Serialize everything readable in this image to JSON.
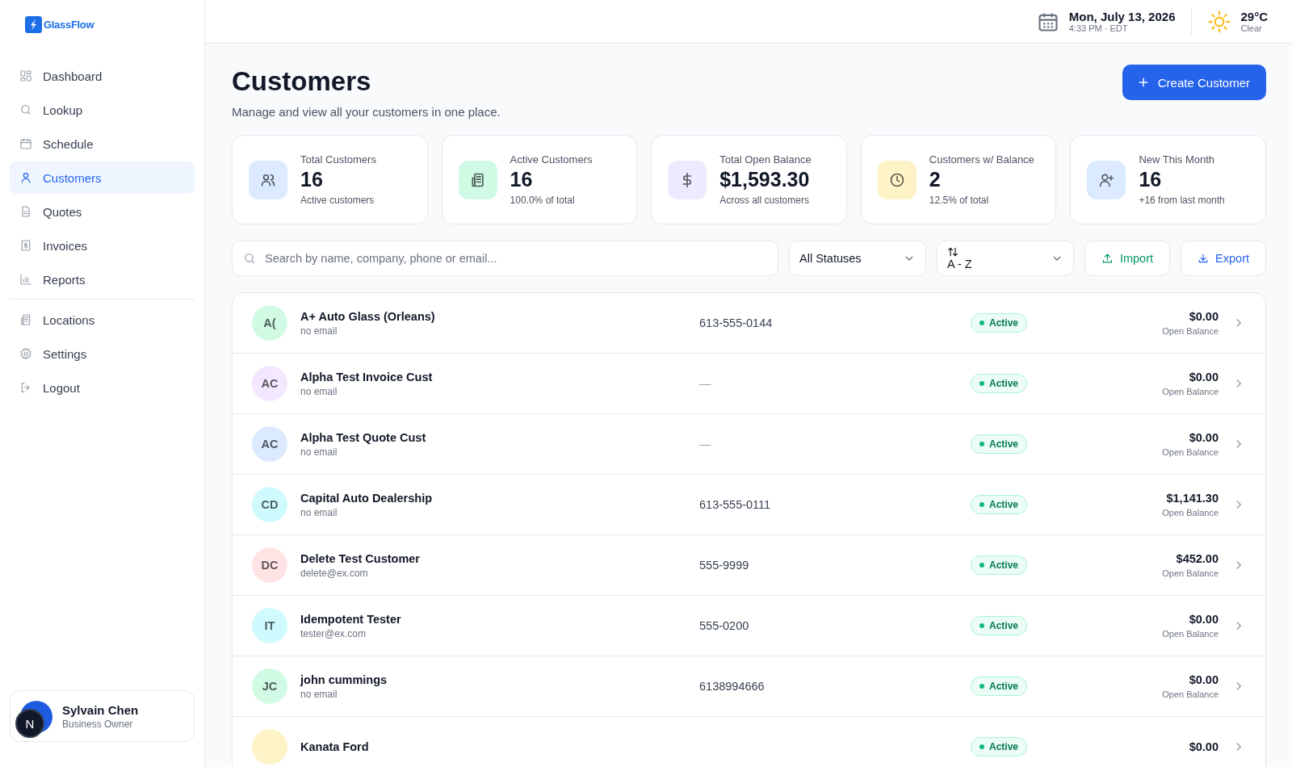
{
  "brand": {
    "name": "GlassFlow"
  },
  "nav": [
    {
      "label": "Dashboard",
      "selected": false
    },
    {
      "label": "Lookup",
      "selected": false
    },
    {
      "label": "Schedule",
      "selected": false
    },
    {
      "label": "Customers",
      "selected": true
    },
    {
      "label": "Quotes",
      "selected": false
    },
    {
      "label": "Invoices",
      "selected": false
    },
    {
      "label": "Reports",
      "selected": false
    }
  ],
  "nav_secondary": [
    {
      "label": "Locations",
      "selected": false
    },
    {
      "label": "Settings",
      "selected": false
    },
    {
      "label": "Logout",
      "selected": false
    }
  ],
  "user": {
    "name": "Sylvain Chen",
    "role": "Business Owner",
    "dev_badge": "N"
  },
  "header": {
    "date": "Mon, July 13, 2026",
    "time": "4:33 PM · EDT",
    "temperature": "29°C",
    "condition": "Clear"
  },
  "page": {
    "title": "Customers",
    "subtitle": "Manage and view all your customers in one place.",
    "create_button": "Create Customer"
  },
  "stats": [
    {
      "label": "Total Customers",
      "value": "16",
      "note": "Active customers",
      "color": "#dbeafe"
    },
    {
      "label": "Active Customers",
      "value": "16",
      "note": "100.0% of total",
      "color": "#d1fae5"
    },
    {
      "label": "Total Open Balance",
      "value": "$1,593.30",
      "note": "Across all customers",
      "color": "#ede9fe"
    },
    {
      "label": "Customers w/ Balance",
      "value": "2",
      "note": "12.5% of total",
      "color": "#fef3c7"
    },
    {
      "label": "New This Month",
      "value": "16",
      "note": "+16 from last month",
      "color": "#dbeafe"
    }
  ],
  "toolbar": {
    "search_placeholder": "Search by name, company, phone or email...",
    "status_filter": "All Statuses",
    "sort": "A - Z",
    "import": "Import",
    "export": "Export"
  },
  "customers": [
    {
      "initials": "A(",
      "color": "#d1fae5",
      "name": "A+ Auto Glass (Orleans)",
      "email": "no email",
      "phone": "613-555-0144",
      "status": "Active",
      "balance": "$0.00",
      "balance_label": "Open Balance"
    },
    {
      "initials": "AC",
      "color": "#f3e8ff",
      "name": "Alpha Test Invoice Cust",
      "email": "no email",
      "phone": "—",
      "status": "Active",
      "balance": "$0.00",
      "balance_label": "Open Balance"
    },
    {
      "initials": "AC",
      "color": "#dbeafe",
      "name": "Alpha Test Quote Cust",
      "email": "no email",
      "phone": "—",
      "status": "Active",
      "balance": "$0.00",
      "balance_label": "Open Balance"
    },
    {
      "initials": "CD",
      "color": "#cffafe",
      "name": "Capital Auto Dealership",
      "email": "no email",
      "phone": "613-555-0111",
      "status": "Active",
      "balance": "$1,141.30",
      "balance_label": "Open Balance"
    },
    {
      "initials": "DC",
      "color": "#ffe4e6",
      "name": "Delete Test Customer",
      "email": "delete@ex.com",
      "phone": "555-9999",
      "status": "Active",
      "balance": "$452.00",
      "balance_label": "Open Balance"
    },
    {
      "initials": "IT",
      "color": "#cffafe",
      "name": "Idempotent Tester",
      "email": "tester@ex.com",
      "phone": "555-0200",
      "status": "Active",
      "balance": "$0.00",
      "balance_label": "Open Balance"
    },
    {
      "initials": "JC",
      "color": "#d1fae5",
      "name": "john cummings",
      "email": "no email",
      "phone": "6138994666",
      "status": "Active",
      "balance": "$0.00",
      "balance_label": "Open Balance"
    },
    {
      "color": "#fef3c7",
      "name": "Kanata Ford",
      "status": "Active",
      "balance": "$0.00"
    }
  ]
}
